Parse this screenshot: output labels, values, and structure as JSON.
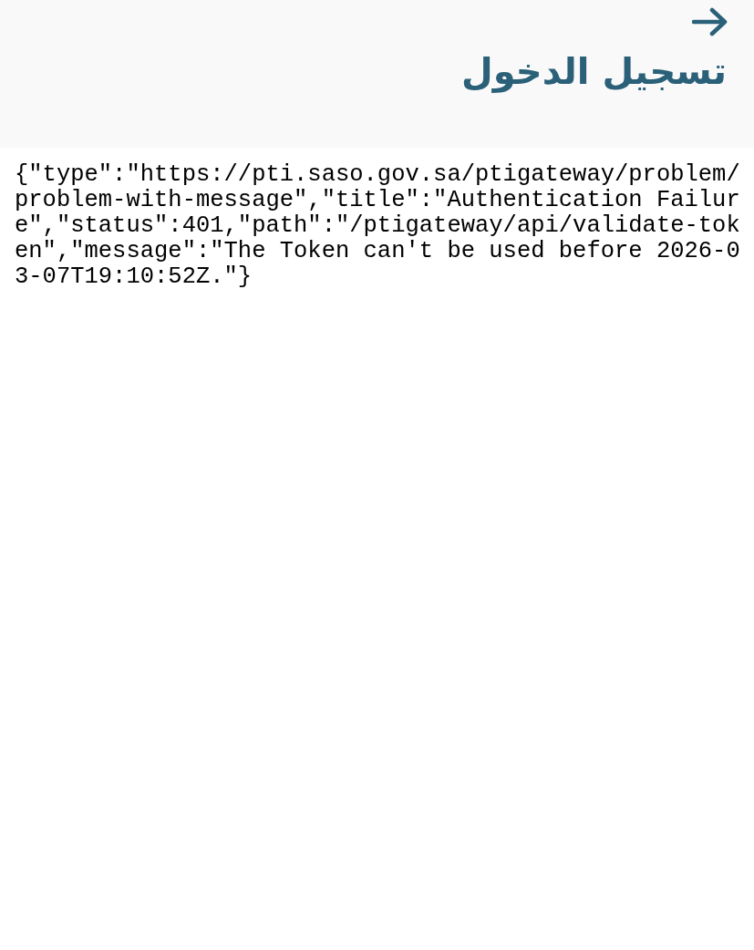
{
  "header": {
    "title": "تسجيل الدخول"
  },
  "response_text": "{\"type\":\"https://pti.saso.gov.sa/ptigateway/problem/problem-with-message\",\"title\":\"Authentication Failure\",\"status\":401,\"path\":\"/ptigateway/api/validate-token\",\"message\":\"The Token can't be used before 2026-03-07T19:10:52Z.\"}"
}
